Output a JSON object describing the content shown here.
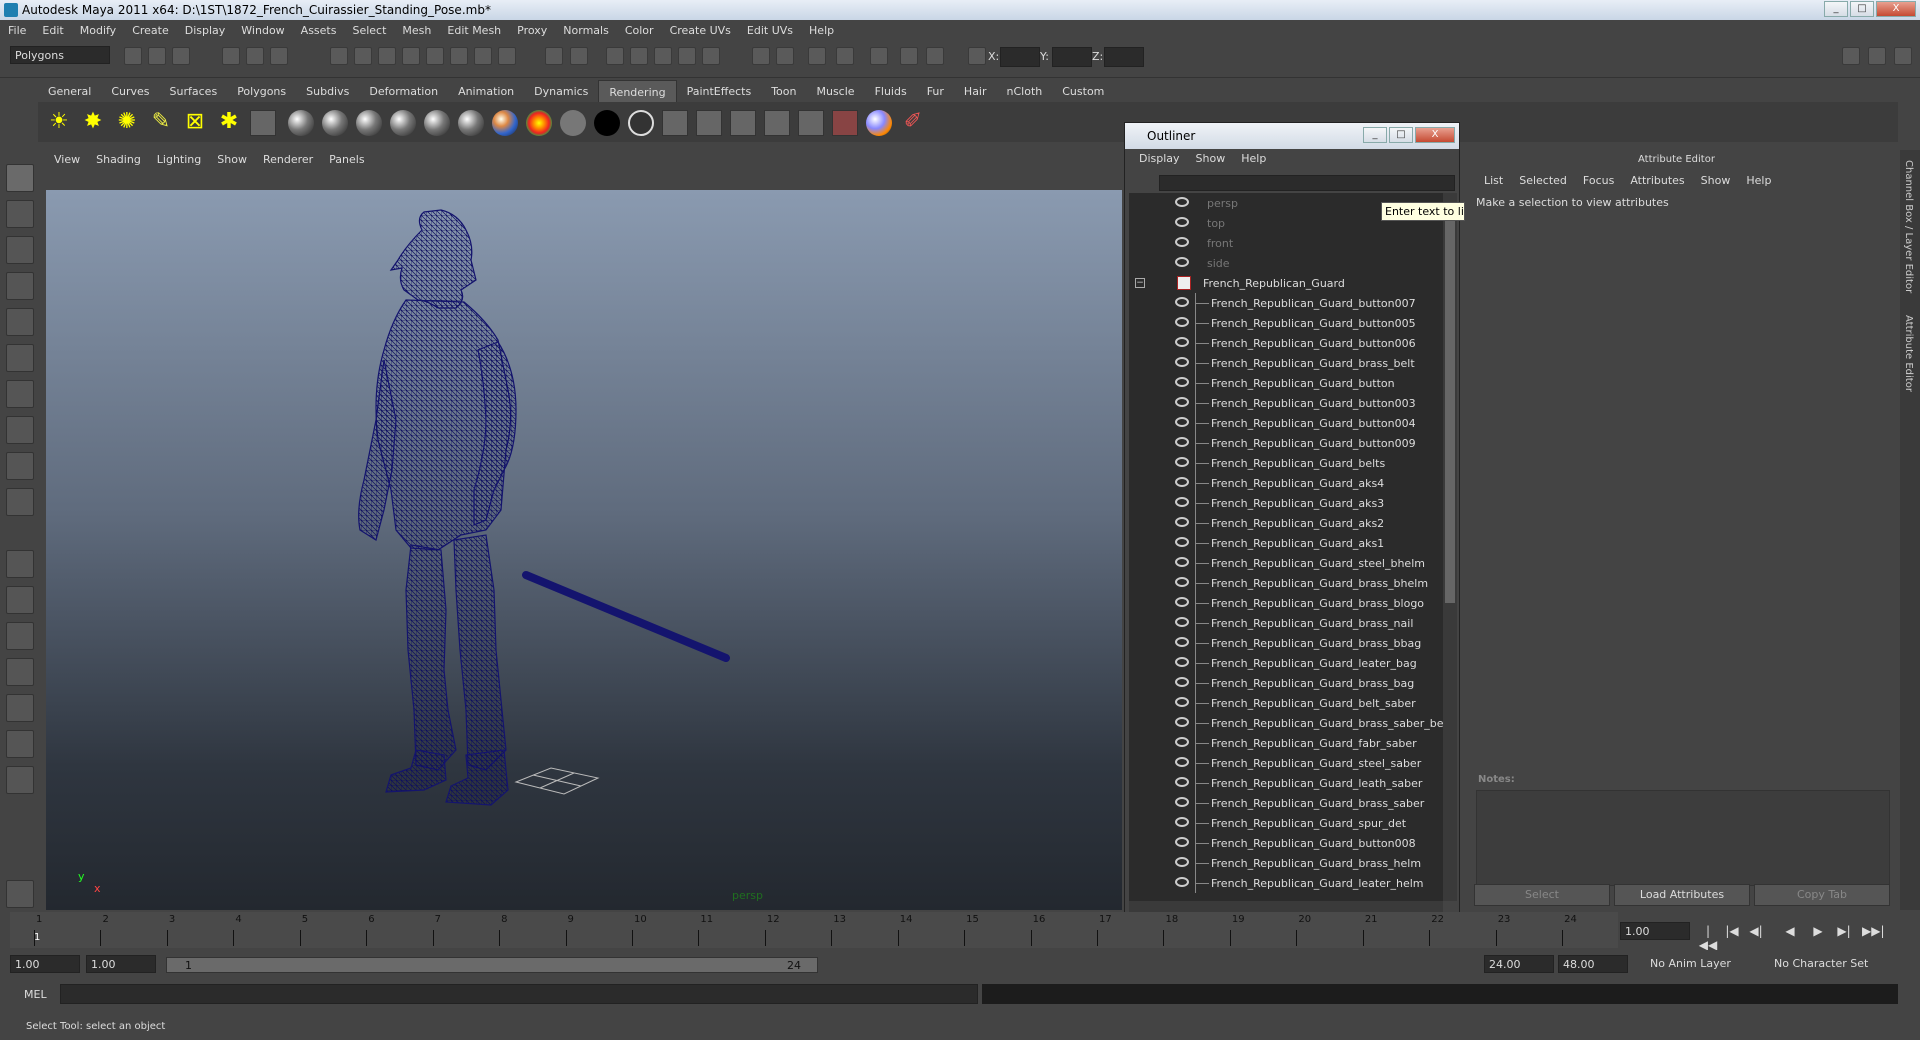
{
  "window": {
    "title": "Autodesk Maya 2011 x64: D:\\1ST\\1872_French_Cuirassier_Standing_Pose.mb*",
    "buttons": [
      "_",
      "□",
      "X"
    ]
  },
  "menubar": [
    "File",
    "Edit",
    "Modify",
    "Create",
    "Display",
    "Window",
    "Assets",
    "Select",
    "Mesh",
    "Edit Mesh",
    "Proxy",
    "Normals",
    "Color",
    "Create UVs",
    "Edit UVs",
    "Help"
  ],
  "status_line": {
    "mode": "Polygons",
    "x_label": "X:",
    "y_label": "Y:",
    "z_label": "Z:"
  },
  "shelf_tabs": [
    "General",
    "Curves",
    "Surfaces",
    "Polygons",
    "Subdivs",
    "Deformation",
    "Animation",
    "Dynamics",
    "Rendering",
    "PaintEffects",
    "Toon",
    "Muscle",
    "Fluids",
    "Fur",
    "Hair",
    "nCloth",
    "Custom"
  ],
  "active_shelf_tab": "Rendering",
  "viewport": {
    "menu": [
      "View",
      "Shading",
      "Lighting",
      "Show",
      "Renderer",
      "Panels"
    ],
    "camera_label": "persp",
    "axis_y": "y",
    "axis_x": "x",
    "wire_color": "#1a1a7a"
  },
  "outliner": {
    "title": "Outliner",
    "menu": [
      "Display",
      "Show",
      "Help"
    ],
    "tooltip": "Enter text to limi",
    "cameras": [
      "persp",
      "top",
      "front",
      "side"
    ],
    "group": "French_Republican_Guard",
    "collapse_glyph": "−",
    "children": [
      "French_Republican_Guard_button007",
      "French_Republican_Guard_button005",
      "French_Republican_Guard_button006",
      "French_Republican_Guard_brass_belt",
      "French_Republican_Guard_button",
      "French_Republican_Guard_button003",
      "French_Republican_Guard_button004",
      "French_Republican_Guard_button009",
      "French_Republican_Guard_belts",
      "French_Republican_Guard_aks4",
      "French_Republican_Guard_aks3",
      "French_Republican_Guard_aks2",
      "French_Republican_Guard_aks1",
      "French_Republican_Guard_steel_bhelm",
      "French_Republican_Guard_brass_bhelm",
      "French_Republican_Guard_brass_blogo",
      "French_Republican_Guard_brass_nail",
      "French_Republican_Guard_brass_bbag",
      "French_Republican_Guard_leater_bag",
      "French_Republican_Guard_brass_bag",
      "French_Republican_Guard_belt_saber",
      "French_Republican_Guard_brass_saber_bel",
      "French_Republican_Guard_fabr_saber",
      "French_Republican_Guard_steel_saber",
      "French_Republican_Guard_leath_saber",
      "French_Republican_Guard_brass_saber",
      "French_Republican_Guard_spur_det",
      "French_Republican_Guard_button008",
      "French_Republican_Guard_brass_helm",
      "French_Republican_Guard_leater_helm"
    ]
  },
  "attribute_editor": {
    "title": "Attribute Editor",
    "menu": [
      "List",
      "Selected",
      "Focus",
      "Attributes",
      "Show",
      "Help"
    ],
    "message": "Make a selection to view attributes",
    "notes_label": "Notes:",
    "buttons": {
      "select": "Select",
      "load": "Load Attributes",
      "copy": "Copy Tab"
    }
  },
  "side_tabs": [
    "Channel Box / Layer Editor",
    "Attribute Editor"
  ],
  "time_slider": {
    "ticks": [
      "1",
      "2",
      "3",
      "4",
      "5",
      "6",
      "7",
      "8",
      "9",
      "10",
      "11",
      "12",
      "13",
      "14",
      "15",
      "16",
      "17",
      "18",
      "19",
      "20",
      "21",
      "22",
      "23",
      "24"
    ],
    "current_marker": "1",
    "current_frame": "1.00",
    "playback": [
      "|◀◀",
      "|◀",
      "◀|",
      "◀",
      "▶",
      "▶|",
      "▶▶|"
    ]
  },
  "range_slider": {
    "start": "1.00",
    "start2": "1.00",
    "range_start": "1",
    "range_end": "24",
    "end": "24.00",
    "end2": "48.00",
    "anim_layer": "No Anim Layer",
    "char_set": "No Character Set"
  },
  "command_line": {
    "label": "MEL"
  },
  "help_line": "Select Tool: select an object"
}
